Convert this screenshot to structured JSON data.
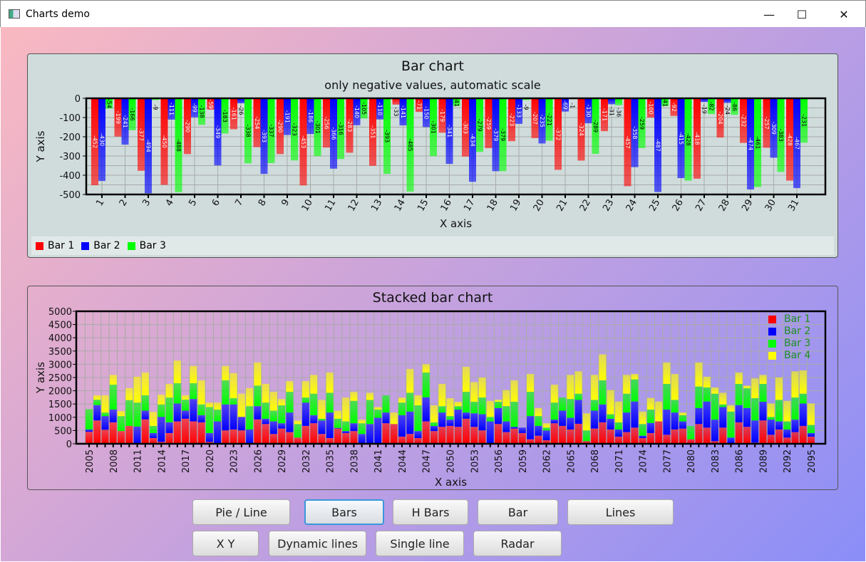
{
  "window": {
    "title": "Charts demo",
    "minimize": "—",
    "maximize": "☐",
    "close": "✕"
  },
  "buttons": {
    "row1": [
      "Pie / Line",
      "Bars",
      "H Bars",
      "Bar",
      "Lines"
    ],
    "row2": [
      "X Y",
      "Dynamic lines",
      "Single line",
      "Radar"
    ],
    "focused": "Bars"
  },
  "colors": {
    "bar1": "#ff0000",
    "bar2": "#0000ff",
    "bar3": "#00ff00",
    "bar4": "#ffff00",
    "legend_text": "#1f8f1f",
    "focus": "#3a96dd"
  },
  "chart_data": [
    {
      "type": "bar",
      "title": "Bar chart",
      "subtitle": "only negative values, automatic scale",
      "xlabel": "X axis",
      "ylabel": "Y axis",
      "ylim": [
        -500,
        0
      ],
      "yticks": [
        0,
        -100,
        -200,
        -300,
        -400,
        -500
      ],
      "grid": true,
      "legend_position": "bottom",
      "categories": [
        "1",
        "2",
        "3",
        "4",
        "5",
        "6",
        "7",
        "8",
        "9",
        "10",
        "11",
        "12",
        "13",
        "14",
        "15",
        "16",
        "17",
        "18",
        "19",
        "20",
        "21",
        "22",
        "23",
        "24",
        "25",
        "26",
        "27",
        "28",
        "29",
        "30",
        "31"
      ],
      "series": [
        {
          "name": "Bar 1",
          "values": [
            -452,
            -199,
            -377,
            -450,
            -290,
            -59,
            -161,
            -254,
            -290,
            -453,
            -256,
            -283,
            -351,
            -33,
            -71,
            -179,
            -303,
            -259,
            -223,
            -207,
            -372,
            -324,
            -171,
            -457,
            -100,
            -92,
            -418,
            -204,
            -232,
            -257,
            -428
          ]
        },
        {
          "name": "Bar 2",
          "values": [
            -430,
            -241,
            -494,
            -111,
            -99,
            -349,
            -26,
            -393,
            -191,
            -186,
            -366,
            -140,
            -110,
            -141,
            -150,
            -341,
            -434,
            -379,
            -133,
            -235,
            -69,
            -130,
            -31,
            -358,
            -487,
            -415,
            -19,
            -24,
            -474,
            -309,
            -467
          ]
        },
        {
          "name": "Bar 3",
          "values": [
            -54,
            -166,
            -9,
            -488,
            -138,
            -183,
            -338,
            -337,
            -323,
            -301,
            -316,
            -105,
            -393,
            -485,
            -301,
            -41,
            -279,
            -379,
            -9,
            -221,
            -1,
            -289,
            -36,
            -259,
            -41,
            -428,
            -82,
            -86,
            -461,
            -383,
            -231
          ]
        }
      ]
    },
    {
      "type": "bar",
      "stacked": true,
      "title": "Stacked bar chart",
      "xlabel": "X axis",
      "ylabel": "Y axis",
      "ylim": [
        0,
        5000
      ],
      "yticks": [
        0,
        500,
        1000,
        1500,
        2000,
        2500,
        3000,
        3500,
        4000,
        4500,
        5000
      ],
      "grid": true,
      "legend_position": "top-right",
      "x_start": 2005,
      "x_end": 2095,
      "x_label_step": 3,
      "series": [
        {
          "name": "Bar 1",
          "values": [
            450,
            880,
            530,
            810,
            480,
            675,
            0,
            920,
            215,
            70,
            405,
            845,
            945,
            845,
            810,
            70,
            0,
            505,
            540,
            505,
            0,
            920,
            745,
            370,
            575,
            440,
            235,
            675,
            775,
            370,
            215,
            575,
            405,
            480,
            0,
            0,
            0,
            775,
            745,
            270,
            370,
            215,
            845,
            480,
            640,
            675,
            640,
            945,
            640,
            505,
            0,
            745,
            440,
            575,
            405,
            170,
            305,
            135,
            775,
            675,
            540,
            755,
            100,
            575,
            810,
            540,
            270,
            440,
            610,
            215,
            405,
            845,
            340,
            540,
            575,
            170,
            745,
            610,
            100,
            610,
            0,
            810,
            640,
            45,
            880,
            340,
            540,
            235,
            440,
            675,
            270
          ]
        },
        {
          "name": "Bar 2",
          "values": [
            90,
            580,
            515,
            480,
            0,
            0,
            650,
            330,
            190,
            945,
            405,
            675,
            305,
            845,
            270,
            335,
            845,
            980,
            945,
            510,
            540,
            500,
            200,
            475,
            200,
            740,
            0,
            880,
            305,
            510,
            965,
            25,
            75,
            295,
            370,
            745,
            980,
            405,
            0,
            810,
            845,
            265,
            910,
            195,
            540,
            235,
            650,
            235,
            510,
            610,
            845,
            605,
            405,
            65,
            205,
            875,
            370,
            370,
            135,
            575,
            440,
            900,
            0,
            675,
            675,
            405,
            270,
            740,
            985,
            90,
            380,
            0,
            950,
            640,
            270,
            0,
            605,
            985,
            810,
            775,
            235,
            650,
            710,
            835,
            705,
            570,
            305,
            305,
            470,
            845,
            135
          ]
        },
        {
          "name": "Bar 3",
          "values": [
            765,
            205,
            135,
            940,
            565,
            975,
            905,
            580,
            270,
            470,
            935,
            765,
            415,
            595,
            405,
            980,
            445,
            910,
            235,
            0,
            880,
            775,
            610,
            405,
            675,
            780,
            510,
            190,
            810,
            65,
            745,
            345,
            365,
            845,
            405,
            910,
            310,
            650,
            0,
            475,
            710,
            970,
            935,
            135,
            240,
            135,
            130,
            780,
            435,
            630,
            170,
            235,
            575,
            945,
            0,
            915,
            370,
            105,
            645,
            495,
            710,
            235,
            405,
            405,
            910,
            170,
            270,
            710,
            835,
            440,
            505,
            0,
            970,
            475,
            235,
            505,
            810,
            530,
            980,
            100,
            980,
            800,
            745,
            840,
            675,
            105,
            810,
            305,
            835,
            370,
            305
          ]
        },
        {
          "name": "Bar 4",
          "values": [
            0,
            165,
            650,
            370,
            195,
            450,
            975,
            860,
            530,
            370,
            515,
            855,
            165,
            650,
            910,
            170,
            265,
            540,
            945,
            875,
            680,
            875,
            705,
            710,
            240,
            405,
            135,
            620,
            710,
            710,
            765,
            305,
            900,
            340,
            135,
            270,
            95,
            0,
            435,
            190,
            900,
            380,
            315,
            640,
            840,
            675,
            165,
            945,
            745,
            755,
            605,
            80,
            605,
            810,
            0,
            675,
            305,
            165,
            675,
            0,
            910,
            845,
            645,
            945,
            980,
            910,
            785,
            710,
            205,
            470,
            440,
            750,
            810,
            980,
            100,
            0,
            910,
            405,
            235,
            440,
            240,
            430,
            100,
            745,
            340,
            505,
            845,
            775,
            990,
            880,
            810
          ]
        }
      ]
    }
  ]
}
